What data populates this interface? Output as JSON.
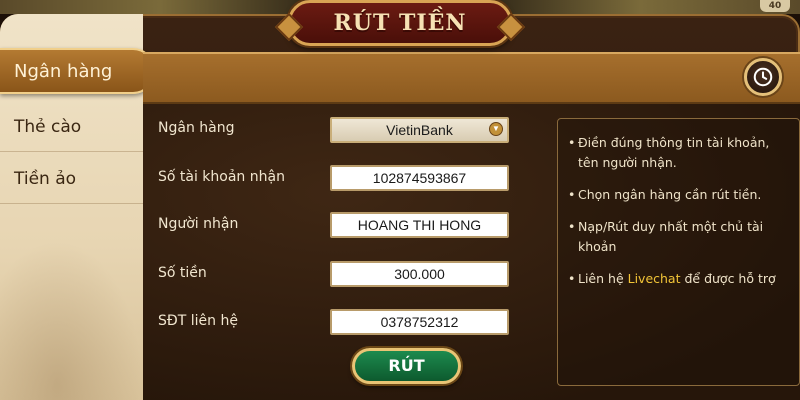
{
  "window": {
    "title": "RÚT TIỀN",
    "corner_badge": "40"
  },
  "sidebar": {
    "tabs": [
      {
        "label": "Ngân hàng",
        "active": true
      },
      {
        "label": "Thẻ cào",
        "active": false
      },
      {
        "label": "Tiền ảo",
        "active": false
      }
    ]
  },
  "header": {
    "history_icon": "clock-history-icon"
  },
  "form": {
    "bank_label": "Ngân hàng",
    "bank_value": "VietinBank",
    "account_label": "Số tài khoản nhận",
    "account_value": "102874593867",
    "recipient_label": "Người nhận",
    "recipient_value": "HOANG THI HONG",
    "amount_label": "Số tiền",
    "amount_value": "300.000",
    "phone_label": "SĐT liên hệ",
    "phone_value": "0378752312",
    "submit_label": "RÚT"
  },
  "notes": {
    "items": [
      {
        "text": "Điền đúng thông tin tài khoản, tên người nhận."
      },
      {
        "text": "Chọn ngân hàng cần rút tiền."
      },
      {
        "text": "Nạp/Rút duy nhất một chủ tài khoản"
      },
      {
        "prefix": "Liên hệ ",
        "highlight": "Livechat",
        "suffix": " để được hỗ trợ"
      }
    ],
    "bullet": "•"
  },
  "colors": {
    "accent_gold": "#d9a454",
    "highlight_yellow": "#f2c437",
    "title_red": "#6b1b12",
    "submit_green": "#1d8a4e"
  }
}
